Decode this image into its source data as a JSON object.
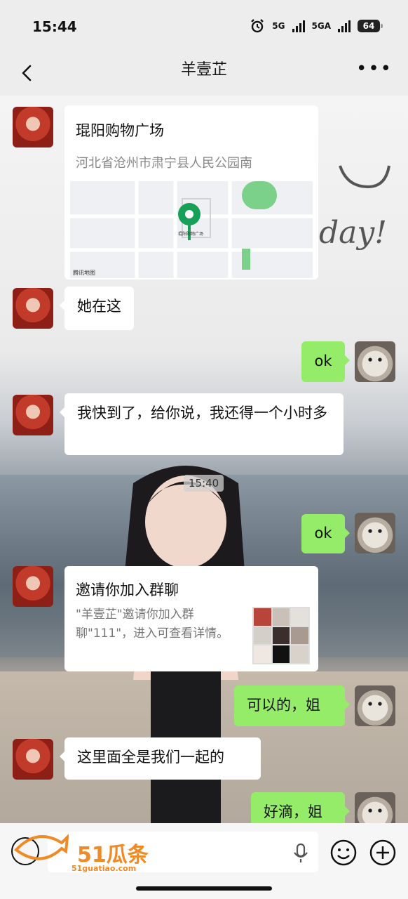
{
  "status_bar": {
    "time": "15:44",
    "net1": "5G",
    "net2": "5GA",
    "battery": "64"
  },
  "header": {
    "title": "羊壹芷"
  },
  "location": {
    "name": "琨阳购物广场",
    "address": "河北省沧州市肃宁县人民公园南",
    "map_center_label": "琨阳购物广场",
    "map_credit": "腾讯地图"
  },
  "messages": {
    "m1": "她在这",
    "m2": "ok",
    "m3": "我快到了，给你说，我还得一个小时多",
    "timestamp": "15:40",
    "m4": "ok",
    "m5": "可以的，姐",
    "m6": "这里面全是我们一起的",
    "m7": "好滴，姐"
  },
  "invite": {
    "title": "邀请你加入群聊",
    "desc": "\"羊壹芷\"邀请你加入群聊\"111\"，进入可查看详情。"
  },
  "watermark": {
    "brand": "51瓜条",
    "url": "51guatiao.com"
  },
  "colors": {
    "bubble_green": "#95ec69",
    "bubble_white": "#ffffff",
    "watermark": "#f08a24"
  }
}
